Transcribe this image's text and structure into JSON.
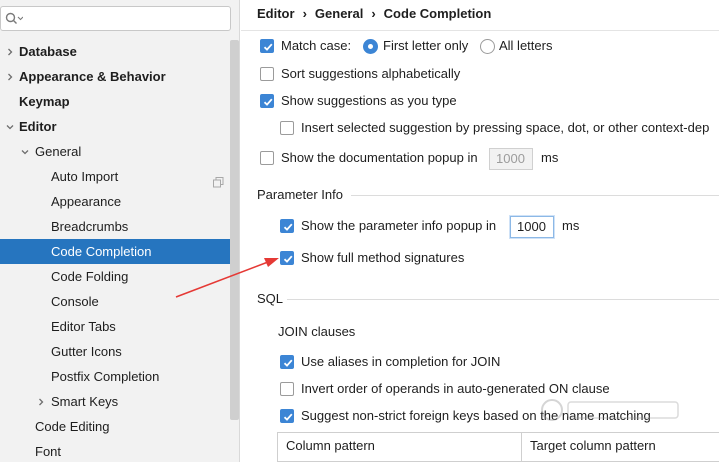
{
  "search": {
    "value": "",
    "placeholder": ""
  },
  "sidebar": {
    "items": [
      {
        "label": "Database",
        "bold": true,
        "chevron": "right"
      },
      {
        "label": "Appearance & Behavior",
        "bold": true,
        "chevron": "right"
      },
      {
        "label": "Keymap",
        "bold": true,
        "chevron": ""
      },
      {
        "label": "Editor",
        "bold": true,
        "chevron": "down"
      },
      {
        "label": "General",
        "bold": false,
        "chevron": "down"
      },
      {
        "label": "Auto Import",
        "bold": false,
        "chevron": "",
        "icon": "copy-icon"
      },
      {
        "label": "Appearance",
        "bold": false,
        "chevron": ""
      },
      {
        "label": "Breadcrumbs",
        "bold": false,
        "chevron": ""
      },
      {
        "label": "Code Completion",
        "bold": false,
        "chevron": "",
        "selected": true
      },
      {
        "label": "Code Folding",
        "bold": false,
        "chevron": ""
      },
      {
        "label": "Console",
        "bold": false,
        "chevron": ""
      },
      {
        "label": "Editor Tabs",
        "bold": false,
        "chevron": ""
      },
      {
        "label": "Gutter Icons",
        "bold": false,
        "chevron": ""
      },
      {
        "label": "Postfix Completion",
        "bold": false,
        "chevron": ""
      },
      {
        "label": "Smart Keys",
        "bold": false,
        "chevron": "right"
      },
      {
        "label": "Code Editing",
        "bold": false,
        "chevron": ""
      },
      {
        "label": "Font",
        "bold": false,
        "chevron": ""
      }
    ]
  },
  "breadcrumb": [
    "Editor",
    "General",
    "Code Completion"
  ],
  "completion": {
    "match_case_label": "Match case:",
    "match_case_checked": true,
    "first_letter_label": "First letter only",
    "first_letter_selected": true,
    "all_letters_label": "All letters",
    "all_letters_selected": false,
    "sort_label": "Sort suggestions alphabetically",
    "sort_checked": false,
    "show_as_you_type_label": "Show suggestions as you type",
    "show_as_you_type_checked": true,
    "insert_selected_label": "Insert selected suggestion by pressing space, dot, or other context-dep",
    "insert_selected_checked": false,
    "doc_popup_label": "Show the documentation popup in",
    "doc_popup_checked": false,
    "doc_popup_value": "1000",
    "doc_popup_unit": "ms"
  },
  "parameter_info": {
    "title": "Parameter Info",
    "popup_label": "Show the parameter info popup in",
    "popup_checked": true,
    "popup_value": "1000",
    "popup_unit": "ms",
    "full_sig_label": "Show full method signatures",
    "full_sig_checked": true
  },
  "sql": {
    "title": "SQL",
    "join_title": "JOIN clauses",
    "aliases_label": "Use aliases in completion for JOIN",
    "aliases_checked": true,
    "invert_label": "Invert order of operands in auto-generated ON clause",
    "invert_checked": false,
    "suggest_label": "Suggest non-strict foreign keys based on the name matching",
    "suggest_checked": true,
    "table_columns": [
      "Column pattern",
      "Target column pattern"
    ]
  },
  "colors": {
    "accent": "#3c85d5",
    "selection": "#2675bf",
    "annotation_arrow": "#e53935"
  }
}
